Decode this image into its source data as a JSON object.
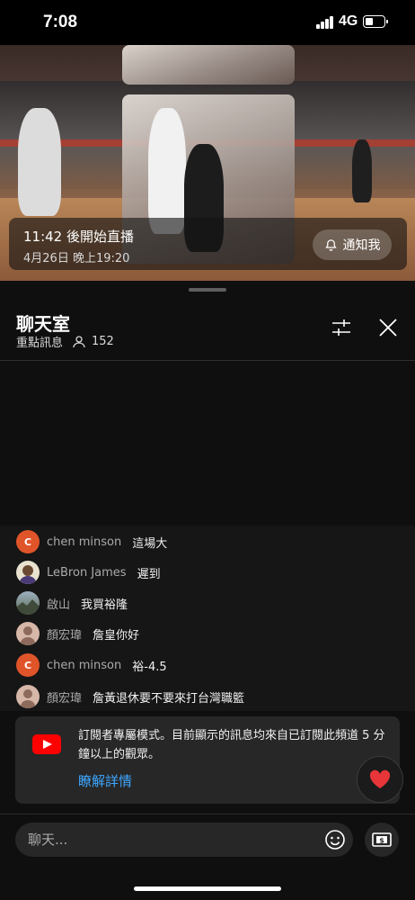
{
  "status_bar": {
    "time": "7:08",
    "network": "4G"
  },
  "video": {
    "countdown": "11:42 後開始直播",
    "start_date": "4月26日 晚上19:20",
    "notify_label": "通知我"
  },
  "chat": {
    "title": "聊天室",
    "mode": "重點訊息",
    "viewer_count": "152"
  },
  "messages": [
    {
      "author": "chen minson",
      "text": "這場大",
      "avatar_letter": "C",
      "avatar_color": "#e0542a"
    },
    {
      "author": "LeBron James",
      "text": "遲到",
      "avatar_letter": "",
      "avatar_color": "#d8c9a0"
    },
    {
      "author": "啟山",
      "text": "我買裕隆",
      "avatar_letter": "",
      "avatar_color": "#6d7b86"
    },
    {
      "author": "顏宏瑋",
      "text": "詹皇你好",
      "avatar_letter": "",
      "avatar_color": "#c9a99b"
    },
    {
      "author": "chen minson",
      "text": "裕-4.5",
      "avatar_letter": "C",
      "avatar_color": "#e0542a"
    },
    {
      "author": "顏宏瑋",
      "text": "詹黃退休要不要來打台灣職籃",
      "avatar_letter": "",
      "avatar_color": "#c9a99b"
    }
  ],
  "member_banner": {
    "text": "訂閱者專屬模式。目前顯示的訊息均來自已訂閱此頻道 5 分鐘以上的觀眾。",
    "link": "瞭解詳情"
  },
  "input": {
    "placeholder": "聊天..."
  },
  "colors": {
    "accent_link": "#3ea6ff",
    "youtube_red": "#ff0000",
    "heart": "#e8353a"
  }
}
